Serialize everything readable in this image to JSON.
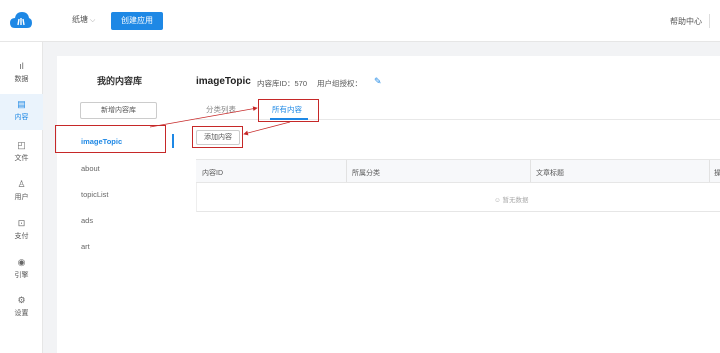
{
  "topbar": {
    "team_name": "纸塘",
    "team_chevron": "⌵",
    "create_app_label": "创建应用",
    "help_label": "帮助中心"
  },
  "nav": {
    "items": [
      {
        "icon": "bar-chart-icon",
        "glyph": "ıl",
        "label": "数据"
      },
      {
        "icon": "document-icon",
        "glyph": "▤",
        "label": "内容"
      },
      {
        "icon": "folder-icon",
        "glyph": "◰",
        "label": "文件"
      },
      {
        "icon": "user-icon",
        "glyph": "♙",
        "label": "用户"
      },
      {
        "icon": "payment-icon",
        "glyph": "⊡",
        "label": "支付"
      },
      {
        "icon": "engine-icon",
        "glyph": "◉",
        "label": "引擎"
      },
      {
        "icon": "settings-icon",
        "glyph": "⚙",
        "label": "设置"
      }
    ],
    "active_index": 1
  },
  "library": {
    "title": "我的内容库",
    "new_button": "新增内容库",
    "items": [
      "imageTopic",
      "about",
      "topicList",
      "ads",
      "art"
    ],
    "active": "imageTopic"
  },
  "content": {
    "title": "imageTopic",
    "lib_id_text": "内容库ID：570",
    "auth_text": "用户组授权：",
    "tabs": [
      "分类列表",
      "所有内容"
    ],
    "active_tab": 1,
    "add_button": "添加内容",
    "table": {
      "columns": [
        "内容ID",
        "所属分类",
        "文章标题",
        "操"
      ],
      "empty_text": "暂无数据"
    }
  },
  "colors": {
    "accent": "#1e88e5",
    "annotation": "#c62828"
  }
}
